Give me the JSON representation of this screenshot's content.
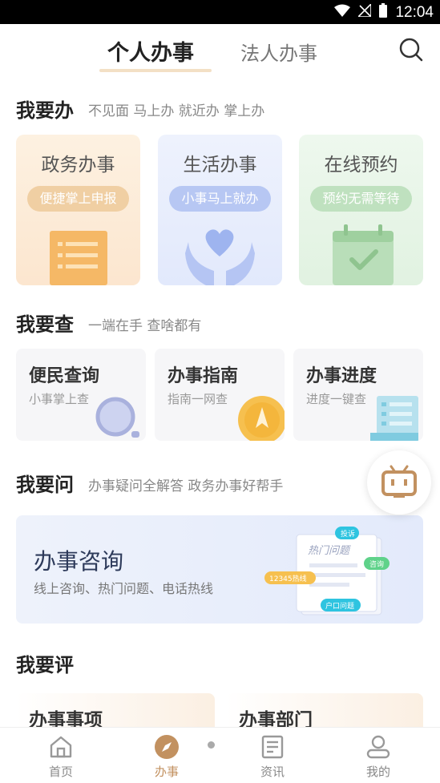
{
  "status_bar": {
    "time": "12:04"
  },
  "header": {
    "tabs": [
      {
        "label": "个人办事",
        "active": true
      },
      {
        "label": "法人办事",
        "active": false
      }
    ]
  },
  "sections": {
    "todo": {
      "title": "我要办",
      "subtitle": "不见面 马上办 就近办 掌上办",
      "cards": [
        {
          "title": "政务办事",
          "pill": "便捷掌上申报"
        },
        {
          "title": "生活办事",
          "pill": "小事马上就办"
        },
        {
          "title": "在线预约",
          "pill": "预约无需等待"
        }
      ]
    },
    "query": {
      "title": "我要查",
      "subtitle": "一端在手 查啥都有",
      "cards": [
        {
          "title": "便民查询",
          "sub": "小事掌上查"
        },
        {
          "title": "办事指南",
          "sub": "指南一网查"
        },
        {
          "title": "办事进度",
          "sub": "进度一键查"
        }
      ]
    },
    "ask": {
      "title": "我要问",
      "subtitle": "办事疑问全解答 政务办事好帮手",
      "card": {
        "title": "办事咨询",
        "sub": "线上咨询、热门问题、电话热线",
        "art_labels": [
          "热门问题",
          "投诉",
          "咨询",
          "12345热线",
          "户口问题"
        ]
      }
    },
    "rate": {
      "title": "我要评",
      "cards": [
        {
          "title": "办事事项"
        },
        {
          "title": "办事部门"
        }
      ]
    }
  },
  "tabbar": {
    "items": [
      {
        "label": "首页",
        "icon": "home-icon",
        "active": false
      },
      {
        "label": "办事",
        "icon": "compass-icon",
        "active": true
      },
      {
        "label": "资讯",
        "icon": "news-icon",
        "active": false
      },
      {
        "label": "我的",
        "icon": "user-icon",
        "active": false
      }
    ]
  },
  "colors": {
    "accent": "#c29160",
    "card_orange": "#fdeedd",
    "card_blue": "#eaf0fd",
    "card_green": "#e8f5e8"
  }
}
